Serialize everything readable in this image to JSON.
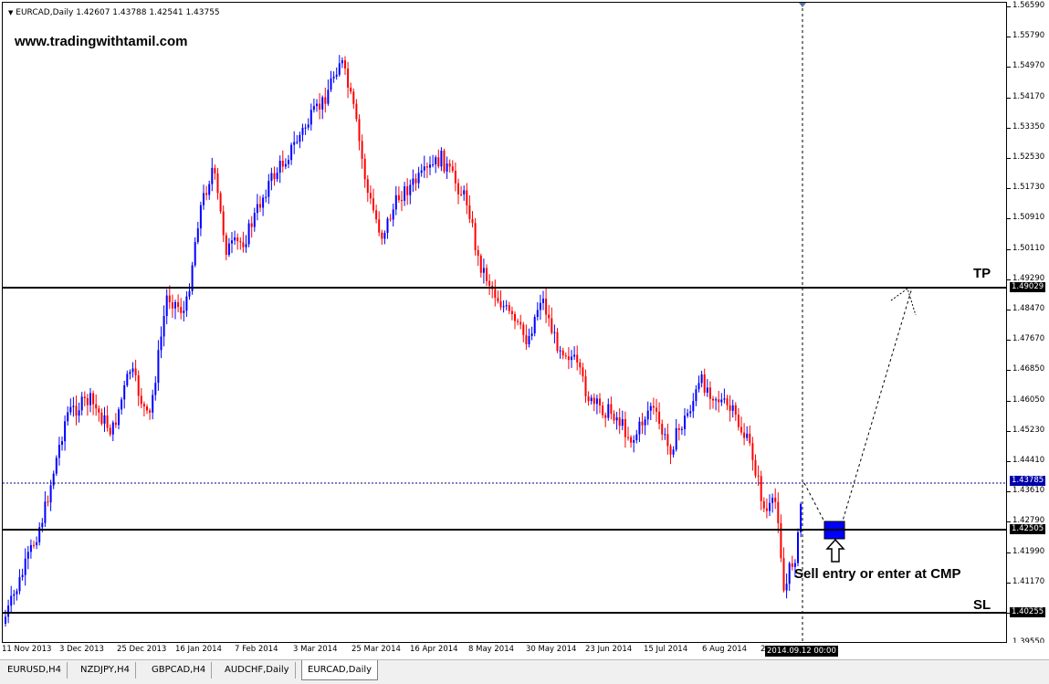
{
  "header": {
    "info": "EURCAD,Daily  1.42607 1.43788 1.42541 1.43755"
  },
  "watermark": "www.tradingwithtamil.com",
  "annotations": {
    "tp": "TP",
    "sl": "SL",
    "entry_note": "Sell entry or enter at CMP"
  },
  "price_labels": {
    "tp": "1.49029",
    "current": "1.43785",
    "entry": "1.42505",
    "sl": "1.40255"
  },
  "crosshair_time": "2014.09.12 00:00",
  "y_axis": [
    "1.56590",
    "1.55790",
    "1.54970",
    "1.54170",
    "1.53350",
    "1.52530",
    "1.51730",
    "1.50910",
    "1.50110",
    "1.49290",
    "1.48470",
    "1.47670",
    "1.46850",
    "1.46050",
    "1.45230",
    "1.44410",
    "1.43610",
    "1.42790",
    "1.41990",
    "1.41170",
    "1.40350",
    "1.39550"
  ],
  "x_axis": [
    "11 Nov 2013",
    "3 Dec 2013",
    "25 Dec 2013",
    "16 Jan 2014",
    "7 Feb 2014",
    "3 Mar 2014",
    "25 Mar 2014",
    "16 Apr 2014",
    "8 May 2014",
    "30 May 2014",
    "23 Jun 2014",
    "15 Jul 2014",
    "6 Aug 2014",
    "2"
  ],
  "tabs": [
    "EURUSD,H4",
    "NZDJPY,H4",
    "GBPCAD,H4",
    "AUDCHF,Daily",
    "EURCAD,Daily"
  ],
  "colors": {
    "bull": "#0000ff",
    "bear": "#ff0000",
    "entry_box": "#0000ff",
    "current_line": "#000080"
  }
}
